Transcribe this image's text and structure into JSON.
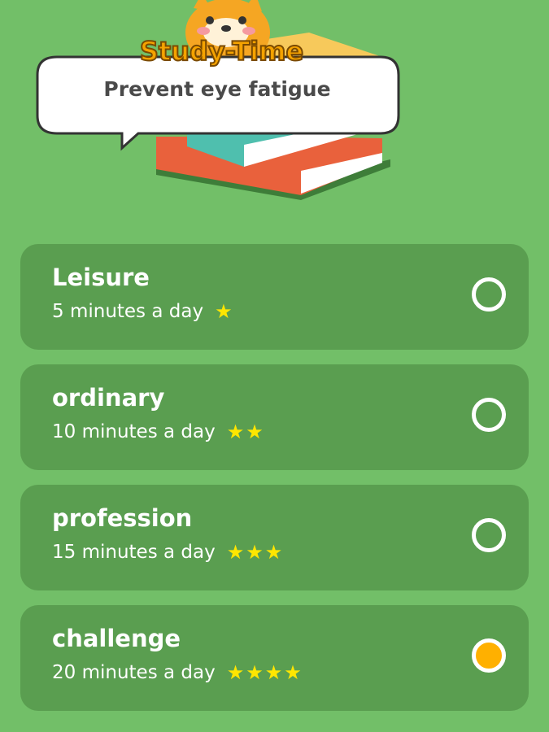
{
  "header": {
    "brand": "Study-Time",
    "subtitle": "Prevent eye fatigue",
    "mascot_icon": "shiba-dog-icon",
    "illustration_icon": "book-stack-icon",
    "brand_color": "#f5a300"
  },
  "colors": {
    "background": "#72bf68",
    "card": "#5a9e50",
    "star": "#ffe600",
    "selected": "#ffb000"
  },
  "options": [
    {
      "title": "Leisure",
      "desc": "5 minutes a day",
      "stars": 1,
      "selected": false
    },
    {
      "title": "ordinary",
      "desc": "10 minutes a day",
      "stars": 2,
      "selected": false
    },
    {
      "title": "profession",
      "desc": "15 minutes a day",
      "stars": 3,
      "selected": false
    },
    {
      "title": "challenge",
      "desc": "20 minutes a day",
      "stars": 4,
      "selected": true
    }
  ]
}
